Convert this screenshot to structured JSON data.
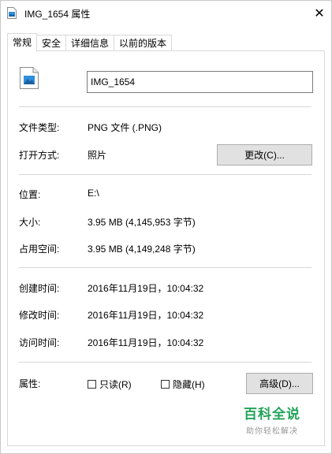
{
  "window": {
    "title": "IMG_1654 属性",
    "close_glyph": "✕"
  },
  "tabs": [
    {
      "label": "常规",
      "active": true
    },
    {
      "label": "安全",
      "active": false
    },
    {
      "label": "详细信息",
      "active": false
    },
    {
      "label": "以前的版本",
      "active": false
    }
  ],
  "file": {
    "icon": "image-file-icon",
    "name": "IMG_1654"
  },
  "type_section": {
    "file_type_label": "文件类型:",
    "file_type_value": "PNG 文件 (.PNG)",
    "open_with_label": "打开方式:",
    "open_with_value": "照片",
    "change_button": "更改(C)..."
  },
  "location_section": {
    "location_label": "位置:",
    "location_value": "E:\\",
    "size_label": "大小:",
    "size_value": "3.95 MB (4,145,953 字节)",
    "size_on_disk_label": "占用空间:",
    "size_on_disk_value": "3.95 MB (4,149,248 字节)"
  },
  "time_section": {
    "created_label": "创建时间:",
    "created_value": "2016年11月19日，10:04:32",
    "modified_label": "修改时间:",
    "modified_value": "2016年11月19日，10:04:32",
    "accessed_label": "访问时间:",
    "accessed_value": "2016年11月19日，10:04:32"
  },
  "attributes": {
    "label": "属性:",
    "readonly_label": "只读(R)",
    "readonly_checked": false,
    "hidden_label": "隐藏(H)",
    "hidden_checked": false,
    "advanced_button": "高级(D)..."
  },
  "watermark": {
    "title": "百科全说",
    "subtitle": "助你轻松解决"
  },
  "colors": {
    "image_icon_blue": "#2f8fdc",
    "watermark_green": "#22a35a"
  }
}
